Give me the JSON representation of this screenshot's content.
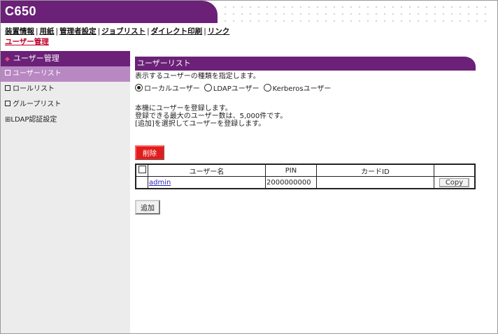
{
  "header": {
    "model": "C650",
    "nav": [
      "装置情報",
      "用紙",
      "管理者設定",
      "ジョブリスト",
      "ダイレクト印刷",
      "リンク"
    ],
    "current_page": "ユーザー管理"
  },
  "sidebar": {
    "heading": "ユーザー管理",
    "items": [
      {
        "label": "ユーザーリスト"
      },
      {
        "label": "ロールリスト"
      },
      {
        "label": "グループリスト"
      },
      {
        "label": "LDAP認証設定"
      }
    ]
  },
  "main": {
    "section_title": "ユーザーリスト",
    "instruction": "表示するユーザーの種類を指定します。",
    "user_types": [
      "ローカルユーザー",
      "LDAPユーザー",
      "Kerberosユーザー"
    ],
    "selected_type": "ローカルユーザー",
    "desc_lines": [
      "本機にユーザーを登録します。",
      "登録できる最大のユーザー数は、5,000件です。",
      "[追加]を選択してユーザーを登録します。"
    ],
    "delete_label": "削除",
    "table": {
      "headers": [
        "ユーザー名",
        "PIN",
        "カードID"
      ],
      "rows": [
        {
          "name": "admin",
          "pin": "2000000000",
          "card_id": "",
          "copy_label": "Copy"
        }
      ]
    },
    "add_label": "追加"
  },
  "colors": {
    "brand_purple": "#6b2178",
    "active_item": "#b888c3",
    "delete_red": "#e11c1c",
    "current_link": "#c0002a"
  }
}
